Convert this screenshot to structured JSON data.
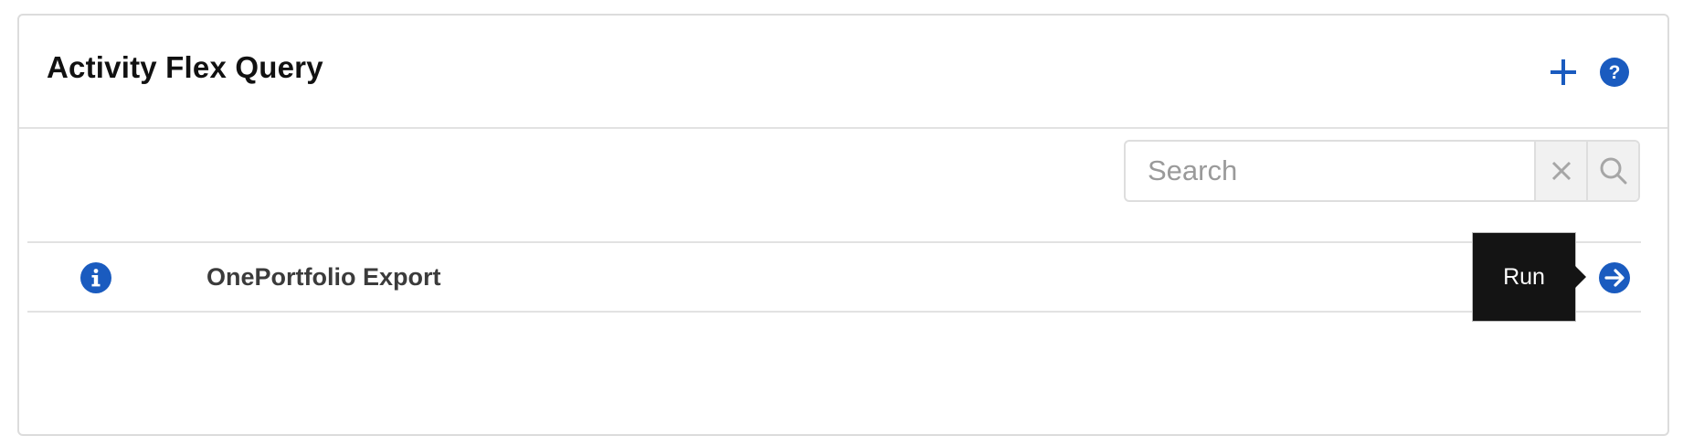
{
  "panel": {
    "title": "Activity Flex Query",
    "add_icon": "plus-icon",
    "help_icon": "question-circle-icon"
  },
  "search": {
    "placeholder": "Search",
    "value": "",
    "clear_icon": "close-icon",
    "search_icon": "search-icon"
  },
  "queries": [
    {
      "name": "OnePortfolio Export",
      "info_icon": "info-circle-icon",
      "run_icon": "arrow-right-circle-icon"
    }
  ],
  "tooltip": {
    "text": "Run"
  },
  "colors": {
    "accent": "#1a5bbf",
    "tooltip_bg": "#141414",
    "border": "#dcdcdc"
  }
}
